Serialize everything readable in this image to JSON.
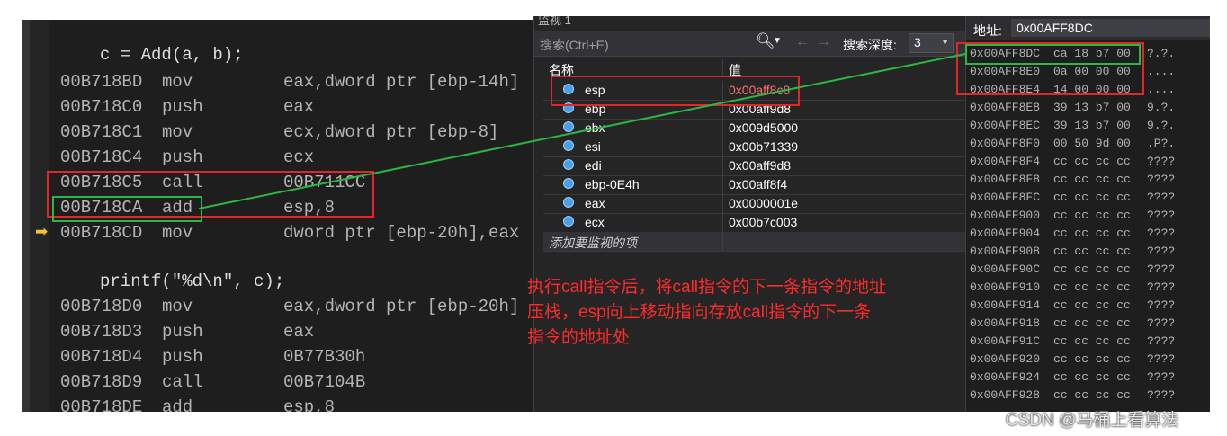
{
  "disasm": {
    "source_lines": [
      "c = Add(a, b);",
      "printf(\"%d\\n\", c);"
    ],
    "instructions_a": [
      {
        "addr": "00B718BD",
        "op": "mov",
        "arg": "eax,dword ptr [ebp-14h]"
      },
      {
        "addr": "00B718C0",
        "op": "push",
        "arg": "eax"
      },
      {
        "addr": "00B718C1",
        "op": "mov",
        "arg": "ecx,dword ptr [ebp-8]"
      },
      {
        "addr": "00B718C4",
        "op": "push",
        "arg": "ecx"
      },
      {
        "addr": "00B718C5",
        "op": "call",
        "arg": "00B711CC"
      },
      {
        "addr": "00B718CA",
        "op": "add",
        "arg": "esp,8"
      },
      {
        "addr": "00B718CD",
        "op": "mov",
        "arg": "dword ptr [ebp-20h],eax"
      }
    ],
    "instructions_b": [
      {
        "addr": "00B718D0",
        "op": "mov",
        "arg": "eax,dword ptr [ebp-20h]"
      },
      {
        "addr": "00B718D3",
        "op": "push",
        "arg": "eax"
      },
      {
        "addr": "00B718D4",
        "op": "push",
        "arg": "0B77B30h"
      },
      {
        "addr": "00B718D9",
        "op": "call",
        "arg": "00B7104B"
      },
      {
        "addr": "00B718DE",
        "op": "add",
        "arg": "esp,8"
      }
    ],
    "ip_arrow_icon": "current-instruction-arrow-icon"
  },
  "watch": {
    "title": "监视 1",
    "search_placeholder": "搜索(Ctrl+E)",
    "search_depth_label": "搜索深度:",
    "search_depth_value": "3",
    "col_name": "名称",
    "col_value": "值",
    "rows": [
      {
        "name": "esp",
        "value": "0x00aff8c8",
        "changed": true
      },
      {
        "name": "ebp",
        "value": "0x00aff9d8",
        "changed": false
      },
      {
        "name": "ebx",
        "value": "0x009d5000",
        "changed": false
      },
      {
        "name": "esi",
        "value": "0x00b71339",
        "changed": false
      },
      {
        "name": "edi",
        "value": "0x00aff9d8",
        "changed": false
      },
      {
        "name": "ebp-0E4h",
        "value": "0x00aff8f4",
        "changed": false
      },
      {
        "name": "eax",
        "value": "0x0000001e",
        "changed": false
      },
      {
        "name": "ecx",
        "value": "0x00b7c003",
        "changed": false
      }
    ],
    "add_item": "添加要监视的项"
  },
  "memory": {
    "address_label": "地址:",
    "address_value": "0x00AFF8DC",
    "rows": [
      {
        "addr": "0x00AFF8DC",
        "bytes": "ca 18 b7 00",
        "ascii": "?.?."
      },
      {
        "addr": "0x00AFF8E0",
        "bytes": "0a 00 00 00",
        "ascii": "...."
      },
      {
        "addr": "0x00AFF8E4",
        "bytes": "14 00 00 00",
        "ascii": "...."
      },
      {
        "addr": "0x00AFF8E8",
        "bytes": "39 13 b7 00",
        "ascii": "9.?."
      },
      {
        "addr": "0x00AFF8EC",
        "bytes": "39 13 b7 00",
        "ascii": "9.?."
      },
      {
        "addr": "0x00AFF8F0",
        "bytes": "00 50 9d 00",
        "ascii": ".P?."
      },
      {
        "addr": "0x00AFF8F4",
        "bytes": "cc cc cc cc",
        "ascii": "????"
      },
      {
        "addr": "0x00AFF8F8",
        "bytes": "cc cc cc cc",
        "ascii": "????"
      },
      {
        "addr": "0x00AFF8FC",
        "bytes": "cc cc cc cc",
        "ascii": "????"
      },
      {
        "addr": "0x00AFF900",
        "bytes": "cc cc cc cc",
        "ascii": "????"
      },
      {
        "addr": "0x00AFF904",
        "bytes": "cc cc cc cc",
        "ascii": "????"
      },
      {
        "addr": "0x00AFF908",
        "bytes": "cc cc cc cc",
        "ascii": "????"
      },
      {
        "addr": "0x00AFF90C",
        "bytes": "cc cc cc cc",
        "ascii": "????"
      },
      {
        "addr": "0x00AFF910",
        "bytes": "cc cc cc cc",
        "ascii": "????"
      },
      {
        "addr": "0x00AFF914",
        "bytes": "cc cc cc cc",
        "ascii": "????"
      },
      {
        "addr": "0x00AFF918",
        "bytes": "cc cc cc cc",
        "ascii": "????"
      },
      {
        "addr": "0x00AFF91C",
        "bytes": "cc cc cc cc",
        "ascii": "????"
      },
      {
        "addr": "0x00AFF920",
        "bytes": "cc cc cc cc",
        "ascii": "????"
      },
      {
        "addr": "0x00AFF924",
        "bytes": "cc cc cc cc",
        "ascii": "????"
      },
      {
        "addr": "0x00AFF928",
        "bytes": "cc cc cc cc",
        "ascii": "????"
      }
    ]
  },
  "annotation": {
    "text": "执行call指令后，将call指令的下一条指令的地址\n压栈，esp向上移动指向存放call指令的下一条\n指令的地址处",
    "color": "#ff2a2a"
  },
  "watermark": "CSDN @马桶上看算法",
  "colors": {
    "highlight_red": "#e0262b",
    "highlight_green": "#2bb744",
    "changed_value": "#ff6e6e"
  }
}
